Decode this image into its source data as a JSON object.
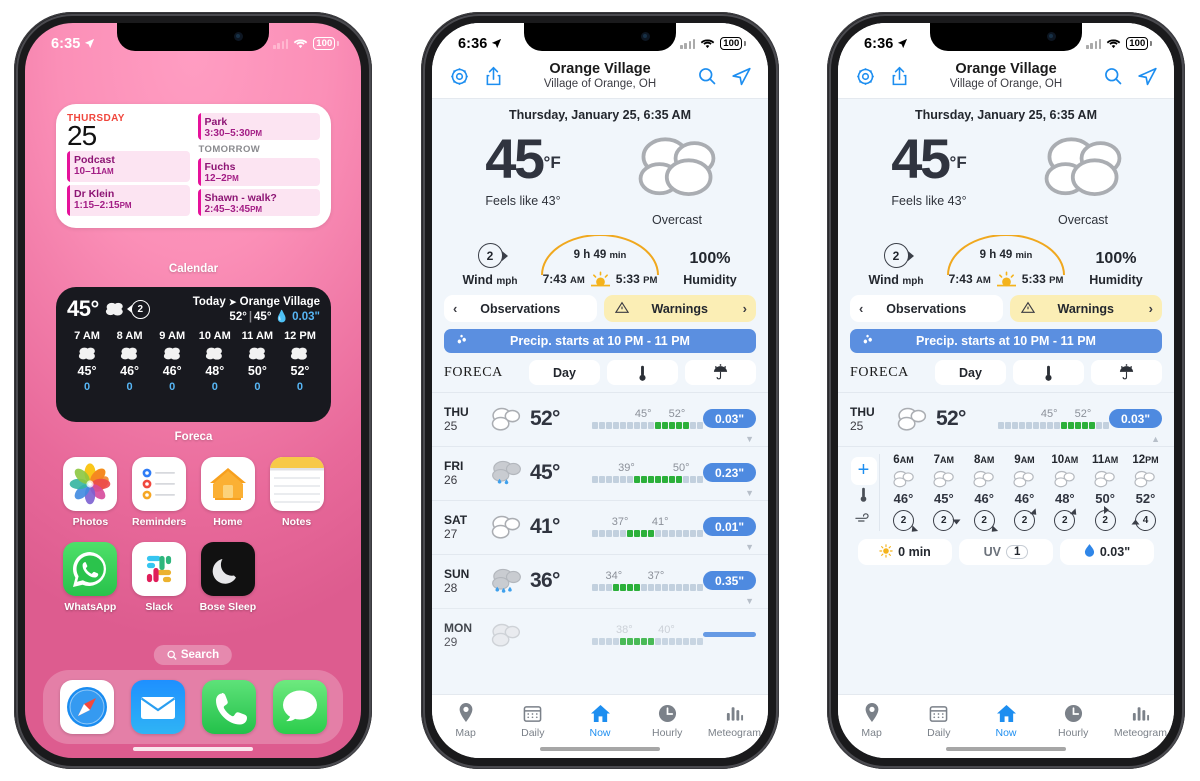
{
  "phone1": {
    "status": {
      "time": "6:35",
      "battery": "100",
      "location_icon": "location-arrow-icon",
      "wifi_icon": "wifi-icon",
      "signal_icon": "cellular-bars-icon"
    },
    "calendar_widget": {
      "label": "Calendar",
      "weekday": "THURSDAY",
      "day": "25",
      "tomorrow_label": "TOMORROW",
      "today_events": [
        {
          "title": "Podcast",
          "time": "10–11",
          "ampm": "AM"
        },
        {
          "title": "Dr Klein",
          "time": "1:15–2:15",
          "ampm": "PM"
        }
      ],
      "right_top_events": [
        {
          "title": "Park",
          "time": "3:30–5:30",
          "ampm": "PM"
        }
      ],
      "tomorrow_events": [
        {
          "title": "Fuchs",
          "time": "12–2",
          "ampm": "PM"
        },
        {
          "title": "Shawn - walk?",
          "time": "2:45–3:45",
          "ampm": "PM"
        }
      ]
    },
    "foreca_widget": {
      "label": "Foreca",
      "current_temp": "45°",
      "wind": "2",
      "today_label": "Today",
      "place": "Orange Village",
      "high": "52°",
      "low": "45°",
      "precip": "0.03\"",
      "hours": [
        {
          "hour": "7 AM",
          "temp": "45°",
          "pop": "0"
        },
        {
          "hour": "8 AM",
          "temp": "46°",
          "pop": "0"
        },
        {
          "hour": "9 AM",
          "temp": "46°",
          "pop": "0"
        },
        {
          "hour": "10 AM",
          "temp": "48°",
          "pop": "0"
        },
        {
          "hour": "11 AM",
          "temp": "50°",
          "pop": "0"
        },
        {
          "hour": "12 PM",
          "temp": "52°",
          "pop": "0"
        }
      ]
    },
    "apps_row1": [
      {
        "name": "Photos",
        "icon": "photos-app-icon"
      },
      {
        "name": "Reminders",
        "icon": "reminders-app-icon"
      },
      {
        "name": "Home",
        "icon": "home-app-icon"
      },
      {
        "name": "Notes",
        "icon": "notes-app-icon"
      }
    ],
    "apps_row2": [
      {
        "name": "WhatsApp",
        "icon": "whatsapp-app-icon"
      },
      {
        "name": "Slack",
        "icon": "slack-app-icon"
      },
      {
        "name": "Bose Sleep",
        "icon": "bose-sleep-app-icon"
      }
    ],
    "search_label": "Search",
    "dock": [
      {
        "name": "Safari",
        "icon": "safari-app-icon"
      },
      {
        "name": "Mail",
        "icon": "mail-app-icon"
      },
      {
        "name": "Phone",
        "icon": "phone-app-icon"
      },
      {
        "name": "Messages",
        "icon": "messages-app-icon"
      }
    ]
  },
  "weather": {
    "status": {
      "time": "6:36",
      "battery": "100"
    },
    "nav": {
      "settings_icon": "gear-icon",
      "share_icon": "share-icon",
      "title": "Orange Village",
      "subtitle": "Village of Orange, OH",
      "search_icon": "search-icon",
      "locate_icon": "navigate-icon"
    },
    "date_line": "Thursday, January 25, 6:35 AM",
    "now": {
      "temp": "45",
      "unit": "°F",
      "feels_like": "Feels like 43°",
      "condition": "Overcast",
      "condition_icon": "overcast-cloud-icon"
    },
    "metrics": {
      "wind_value": "2",
      "wind_label": "Wind",
      "wind_unit": "mph",
      "daylight": "9 h 49",
      "daylight_unit": "min",
      "sunrise": "7:43",
      "sunrise_ampm": "AM",
      "sunset": "5:33",
      "sunset_ampm": "PM",
      "sun_icon": "sunrise-sunset-icon",
      "humidity_value": "100%",
      "humidity_label": "Humidity"
    },
    "segments": {
      "observations": "Observations",
      "warnings": "Warnings",
      "warning_icon": "warning-triangle-icon",
      "prev_chevron": "‹",
      "next_chevron": "›"
    },
    "precip_banner": {
      "text": "Precip. starts at 10 PM - 11 PM",
      "icon": "raindrops-icon"
    },
    "foreca_header": {
      "logo": "FORECA",
      "day_btn": "Day",
      "temp_btn_icon": "thermometer-icon",
      "precip_btn_icon": "umbrella-rain-icon"
    },
    "days": [
      {
        "dow": "THU",
        "date": "25",
        "icon": "cloudy-icon",
        "temp": "52°",
        "low": "45°",
        "high": "52°",
        "pop": "0.03\"",
        "bar_fill_start": 9,
        "bar_fill_end": 13
      },
      {
        "dow": "FRI",
        "date": "26",
        "icon": "rain-icon",
        "temp": "45°",
        "low": "39°",
        "high": "50°",
        "pop": "0.23\"",
        "bar_fill_start": 6,
        "bar_fill_end": 12
      },
      {
        "dow": "SAT",
        "date": "27",
        "icon": "cloudy-icon",
        "temp": "41°",
        "low": "37°",
        "high": "41°",
        "pop": "0.01\"",
        "bar_fill_start": 5,
        "bar_fill_end": 8
      },
      {
        "dow": "SUN",
        "date": "28",
        "icon": "rain-icon",
        "temp": "36°",
        "low": "34°",
        "high": "37°",
        "pop": "0.35\"",
        "bar_fill_start": 3,
        "bar_fill_end": 6
      },
      {
        "dow": "MON",
        "date": "29",
        "icon": "cloudy-icon",
        "temp": "",
        "low": "",
        "high": "",
        "pop": "",
        "bar_fill_start": 4,
        "bar_fill_end": 8
      }
    ],
    "expanded": {
      "plus_label": "+",
      "thermometer_icon": "thermometer-icon",
      "wind_icon": "wind-icon",
      "hours": [
        {
          "hour": "6",
          "ampm": "AM",
          "temp": "46°",
          "wind": "2",
          "dir": 135
        },
        {
          "hour": "7",
          "ampm": "AM",
          "temp": "45°",
          "wind": "2",
          "dir": 90
        },
        {
          "hour": "8",
          "ampm": "AM",
          "temp": "46°",
          "wind": "2",
          "dir": 135
        },
        {
          "hour": "9",
          "ampm": "AM",
          "temp": "46°",
          "wind": "2",
          "dir": 45
        },
        {
          "hour": "10",
          "ampm": "AM",
          "temp": "48°",
          "wind": "2",
          "dir": 45
        },
        {
          "hour": "11",
          "ampm": "AM",
          "temp": "50°",
          "wind": "2",
          "dir": 0
        },
        {
          "hour": "12",
          "ampm": "PM",
          "temp": "52°",
          "wind": "4",
          "dir": 270
        }
      ],
      "stats": [
        {
          "icon": "sun-icon",
          "label": "0 min"
        },
        {
          "icon": "uv-icon",
          "label": "UV",
          "badge": "1"
        },
        {
          "icon": "droplet-icon",
          "label": "0.03\""
        }
      ]
    },
    "tabs": [
      {
        "label": "Map",
        "icon": "map-pin-icon",
        "active": false
      },
      {
        "label": "Daily",
        "icon": "calendar-icon",
        "active": false
      },
      {
        "label": "Now",
        "icon": "home-icon",
        "active": true
      },
      {
        "label": "Hourly",
        "icon": "clock-icon",
        "active": false
      },
      {
        "label": "Meteogram",
        "icon": "bar-chart-icon",
        "active": false
      }
    ]
  },
  "colors": {
    "pink_bg": "#f286ae",
    "accent_blue": "#1d8ef0",
    "precip_blue": "#5b8fe0",
    "warn_yellow": "#fbeeb5",
    "event_pink": "#fce4f2",
    "event_accent": "#e6119b",
    "cal_red": "#f0463c"
  }
}
